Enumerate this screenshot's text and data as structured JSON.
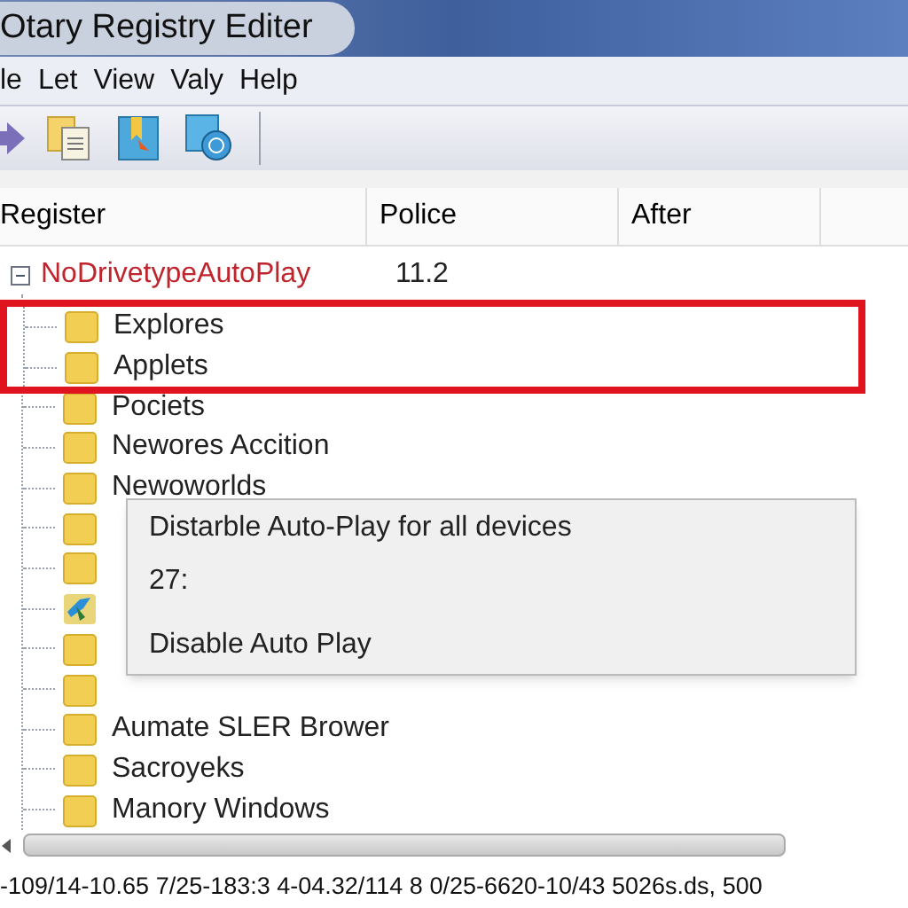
{
  "window": {
    "title": "Otary Registry Editer"
  },
  "menu": [
    "le",
    "Let",
    "View",
    "Valy",
    "Help"
  ],
  "toolbar": [
    {
      "kind": "arrow"
    },
    {
      "kind": "pages"
    },
    {
      "kind": "bookmark"
    },
    {
      "kind": "globe"
    }
  ],
  "table": {
    "columns": [
      "Register",
      "Police",
      "After"
    ]
  },
  "tree": {
    "label": "NoDrivetypeAutoPlay",
    "value": "11.2",
    "expanded": true,
    "children": [
      {
        "label": "Explores",
        "kind": "folder",
        "highlighted": true
      },
      {
        "label": "Applets",
        "kind": "folder",
        "highlighted": true
      },
      {
        "label": "Pociets",
        "kind": "folder",
        "highlighted": false
      },
      {
        "label": "Newores Accition",
        "kind": "folder",
        "highlighted": false
      },
      {
        "label": "Newoworlds",
        "kind": "folder",
        "highlighted": false
      },
      {
        "kind": "folder",
        "highlighted": false
      },
      {
        "kind": "folder",
        "highlighted": false
      },
      {
        "kind": "app",
        "highlighted": false
      },
      {
        "kind": "folder",
        "highlighted": false
      },
      {
        "kind": "folder",
        "highlighted": false
      },
      {
        "label": "Aumate SLER Brower",
        "kind": "folder",
        "highlighted": false
      },
      {
        "label": "Sacroyeks",
        "kind": "folder",
        "highlighted": false
      },
      {
        "label": "Manory Windows",
        "kind": "folder",
        "highlighted": false
      }
    ]
  },
  "popup": {
    "lines": [
      "Distarble Auto-Play for all devices",
      "27:",
      "Disable Auto Play"
    ]
  },
  "status_bar": "-109/14-10.65 7/25-183:3 4-04.32/114 8 0/25-6620-10/43 5026s.ds, 500"
}
